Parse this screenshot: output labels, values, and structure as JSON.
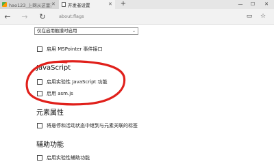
{
  "browser": {
    "tabs": [
      {
        "label": "hao123_上网从这里开始",
        "active": false,
        "icon": "hao123-favicon"
      },
      {
        "label": "开发者设置",
        "active": true,
        "icon": "page-favicon"
      }
    ],
    "tab_close_glyph": "✕",
    "new_tab_glyph": "+",
    "window_controls": {
      "minimize": "—",
      "maximize": "☐",
      "close": "✕"
    },
    "nav": {
      "back_glyph": "←",
      "forward_glyph": "→",
      "refresh_glyph": "↻",
      "address": "about:flags",
      "right_icons": [
        "reading-view-icon",
        "favorites-star-icon"
      ],
      "reading_glyph": "▭",
      "favorite_glyph": "☆"
    }
  },
  "page": {
    "select": {
      "value": "仅在启用触摸时启用",
      "arrow_glyph": "⌄"
    },
    "mspointer_label": "启用 MSPointer 事件接口",
    "javascript": {
      "heading": "JavaScript",
      "options": [
        {
          "label": "启用实验性 JavaScript 功能",
          "checked": false
        },
        {
          "label": "启用 asm.js",
          "checked": false
        }
      ]
    },
    "element_properties": {
      "heading": "元素属性",
      "options": [
        {
          "label": "将悬停和活动状态中继到与元素关联的标签",
          "checked": false
        }
      ]
    },
    "accessibility": {
      "heading": "辅助功能",
      "options": [
        {
          "label": "启用实验性辅助功能",
          "checked": false
        }
      ]
    }
  },
  "colors": {
    "annotation": "#e0201b",
    "tabstrip": "#e6e6e6",
    "active_tab": "#f2f2f2"
  }
}
